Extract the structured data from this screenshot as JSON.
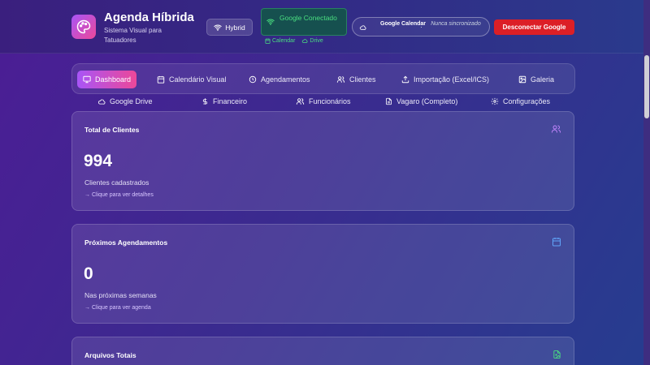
{
  "header": {
    "title": "Agenda Híbrida",
    "subtitle": "Sistema Visual para Tatuadores",
    "mode_label": "Hybrid",
    "google_status": "Google Conectado",
    "google_links": [
      "Calendar",
      "Drive"
    ],
    "sync_label": "Google Calendar",
    "sync_separator": "·",
    "sync_value": "Nunca sincronizado",
    "disconnect_label": "Desconectar Google"
  },
  "nav": {
    "row1": [
      {
        "label": "Dashboard",
        "icon": "monitor-icon",
        "active": true
      },
      {
        "label": "Calendário Visual",
        "icon": "calendar-icon"
      },
      {
        "label": "Agendamentos",
        "icon": "clock-icon"
      },
      {
        "label": "Clientes",
        "icon": "users-icon"
      },
      {
        "label": "Importação (Excel/ICS)",
        "icon": "upload-icon"
      },
      {
        "label": "Galeria",
        "icon": "image-icon"
      }
    ],
    "row2": [
      {
        "label": "Google Drive",
        "icon": "cloud-icon"
      },
      {
        "label": "Financeiro",
        "icon": "dollar-icon"
      },
      {
        "label": "Funcionários",
        "icon": "users-icon"
      },
      {
        "label": "Vagaro (Completo)",
        "icon": "file-icon"
      },
      {
        "label": "Configurações",
        "icon": "gear-icon"
      }
    ]
  },
  "cards": [
    {
      "title": "Total de Clientes",
      "value": "994",
      "desc": "Clientes cadastrados",
      "link": "→ Clique para ver detalhes",
      "icon": "users-icon"
    },
    {
      "title": "Próximos Agendamentos",
      "value": "0",
      "desc": "Nas próximas semanas",
      "link": "→ Clique para ver agenda",
      "icon": "calendar-icon"
    },
    {
      "title": "Arquivos Totais",
      "icon": "file-image-icon"
    }
  ],
  "colors": {
    "accent_gradient_start": "#a855f7",
    "accent_gradient_end": "#ec4899",
    "connected_green": "#4ade80",
    "danger_red": "#dc1f26",
    "card_icon_purple": "#c084fc",
    "card_icon_blue": "#60a5fa",
    "card_icon_green": "#4ade80"
  }
}
